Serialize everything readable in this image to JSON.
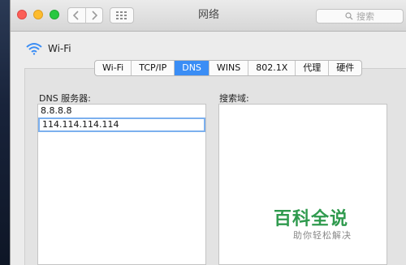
{
  "window": {
    "title": "网络"
  },
  "toolbar": {
    "back_icon": "chevron-left-icon",
    "forward_icon": "chevron-right-icon",
    "grid_icon": "grid-icon",
    "search_placeholder": "搜索"
  },
  "interface": {
    "name": "Wi-Fi",
    "icon": "wifi-icon"
  },
  "tabs": [
    {
      "label": "Wi-Fi",
      "active": false
    },
    {
      "label": "TCP/IP",
      "active": false
    },
    {
      "label": "DNS",
      "active": true
    },
    {
      "label": "WINS",
      "active": false
    },
    {
      "label": "802.1X",
      "active": false
    },
    {
      "label": "代理",
      "active": false
    },
    {
      "label": "硬件",
      "active": false
    }
  ],
  "dns": {
    "label": "DNS 服务器:",
    "servers": [
      "8.8.8.8",
      "114.114.114.114"
    ],
    "editing_index": 1
  },
  "search_domains": {
    "label": "搜索域:",
    "items": []
  },
  "watermark": {
    "title": "百科全说",
    "subtitle": "助你轻松解决"
  },
  "colors": {
    "accent": "#3a8df5",
    "watermark": "#2f9a4e"
  }
}
